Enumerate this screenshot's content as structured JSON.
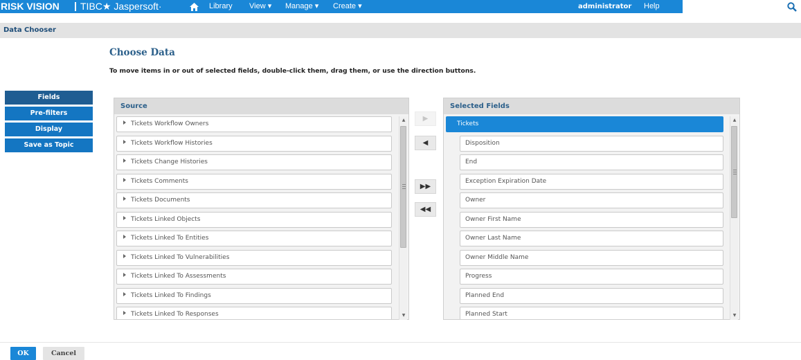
{
  "header": {
    "brand_main": "RISK VISION",
    "brand_secondary": "TIBC★ Jaspersoft·",
    "nav": [
      {
        "label": "Library"
      },
      {
        "label": "View ▾"
      },
      {
        "label": "Manage ▾"
      },
      {
        "label": "Create ▾"
      }
    ],
    "user": "administrator",
    "help": "Help",
    "icons": {
      "home": "home-icon",
      "search": "search-icon"
    }
  },
  "page": {
    "title": "Data Chooser",
    "heading": "Choose Data",
    "instructions": "To move items in or out of selected fields, double-click them, drag them, or use the direction buttons."
  },
  "leftnav": [
    {
      "label": "Fields",
      "active": true
    },
    {
      "label": "Pre-filters"
    },
    {
      "label": "Display"
    },
    {
      "label": "Save as Topic"
    }
  ],
  "source": {
    "title": "Source",
    "items": [
      "Tickets Workflow Owners",
      "Tickets Workflow Histories",
      "Tickets Change Histories",
      "Tickets Comments",
      "Tickets Documents",
      "Tickets Linked Objects",
      "Tickets Linked To Entities",
      "Tickets Linked To Vulnerabilities",
      "Tickets Linked To Assessments",
      "Tickets Linked To Findings",
      "Tickets Linked To Responses"
    ]
  },
  "selected": {
    "title": "Selected Fields",
    "group": "Tickets",
    "items": [
      "Disposition",
      "End",
      "Exception Expiration Date",
      "Owner",
      "Owner First Name",
      "Owner Last Name",
      "Owner Middle Name",
      "Progress",
      "Planned End",
      "Planned Start"
    ]
  },
  "direction_buttons": [
    {
      "icon": "▶",
      "name": "move-right-button",
      "disabled": true
    },
    {
      "icon": "◀",
      "name": "move-left-button"
    },
    {
      "icon": "▶▶",
      "name": "move-all-right-button"
    },
    {
      "icon": "◀◀",
      "name": "move-all-left-button"
    }
  ],
  "footer": {
    "ok": "OK",
    "cancel": "Cancel"
  },
  "colors": {
    "accent": "#1a87d7",
    "nav_active": "#1f5d92",
    "heading": "#2b5f8a"
  }
}
